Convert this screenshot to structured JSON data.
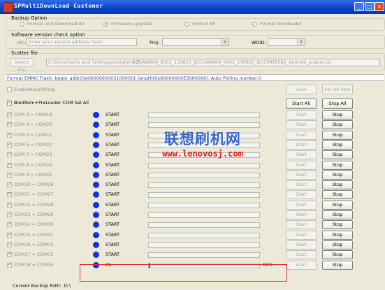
{
  "window": {
    "title": "SPMultiDownLoad Customer"
  },
  "backup": {
    "legend": "Backup Option",
    "options": [
      {
        "label": "Format and Download All",
        "selected": false
      },
      {
        "label": "Firmware upgrade",
        "selected": true
      },
      {
        "label": "Format All",
        "selected": false
      },
      {
        "label": "Format bootloader",
        "selected": false
      }
    ]
  },
  "version_check": {
    "legend": "Software version check option",
    "url_label": "URL:",
    "url_value": "Enter your service address here!",
    "proj_label": "Proj:",
    "woid_label": "WOID:"
  },
  "scatter": {
    "legend": "Scatter file",
    "select_button": "Select File",
    "path": "C:\\Documents and Settings\\wangfei\\桌面\\AW800_S002_130815_DCC\\AW800_S002_130815_DCC\\MT6582_Android_scatter.txt"
  },
  "info_line": "Format EMMC Flash:  begin_addr(0x0000000003100000), length(0x00000000E3000000). Auto Polling number:0",
  "auto_polling": {
    "label": "EnableAutoPolling",
    "checked": false
  },
  "scan_button": "Scan",
  "set_bk_path_button": "Set BK Path",
  "bootrom": {
    "label": "BootRom+PreLoader COM Sel All",
    "checked": true
  },
  "start_all_button": "Start All",
  "stop_all_button": "Stop All",
  "row_start_label": "Start",
  "row_stop_label": "Stop",
  "rows": [
    {
      "com": "COM 3 = COM19",
      "status": "START",
      "progress": 0,
      "pct": ""
    },
    {
      "com": "COM 4 = COM20",
      "status": "START",
      "progress": 0,
      "pct": ""
    },
    {
      "com": "COM 5 = COM21",
      "status": "START",
      "progress": 0,
      "pct": ""
    },
    {
      "com": "COM 6 = COM22",
      "status": "START",
      "progress": 0,
      "pct": ""
    },
    {
      "com": "COM 7 = COM23",
      "status": "START",
      "progress": 0,
      "pct": ""
    },
    {
      "com": "COM 8 = COM24",
      "status": "START",
      "progress": 0,
      "pct": ""
    },
    {
      "com": "COM 9 = COM25",
      "status": "START",
      "progress": 0,
      "pct": ""
    },
    {
      "com": "COM10 = COM26",
      "status": "START",
      "progress": 0,
      "pct": ""
    },
    {
      "com": "COM11 = COM27",
      "status": "START",
      "progress": 0,
      "pct": ""
    },
    {
      "com": "COM12 = COM28",
      "status": "START",
      "progress": 0,
      "pct": ""
    },
    {
      "com": "COM13 = COM29",
      "status": "START",
      "progress": 0,
      "pct": ""
    },
    {
      "com": "COM14 = COM30",
      "status": "START",
      "progress": 0,
      "pct": ""
    },
    {
      "com": "COM15 = COM31",
      "status": "START",
      "progress": 0,
      "pct": ""
    },
    {
      "com": "COM16 = COM32",
      "status": "START",
      "progress": 0,
      "pct": ""
    },
    {
      "com": "COM17 = COM33",
      "status": "START",
      "progress": 0,
      "pct": ""
    },
    {
      "com": "COM18 = COM34",
      "status": "DL",
      "progress": 0.01,
      "pct": "01%"
    }
  ],
  "watermark": {
    "cn": "联想刷机网",
    "url": "www.lenovosj.com"
  },
  "footer": {
    "label": "Current BackUp Path:",
    "value": "D:\\"
  },
  "colors": {
    "titlebar": "#0a3fc8",
    "status_ball": "#1530e0",
    "progress_fill": "#1a4ad8",
    "info_text": "#3040b0",
    "highlight": "#e03030"
  }
}
